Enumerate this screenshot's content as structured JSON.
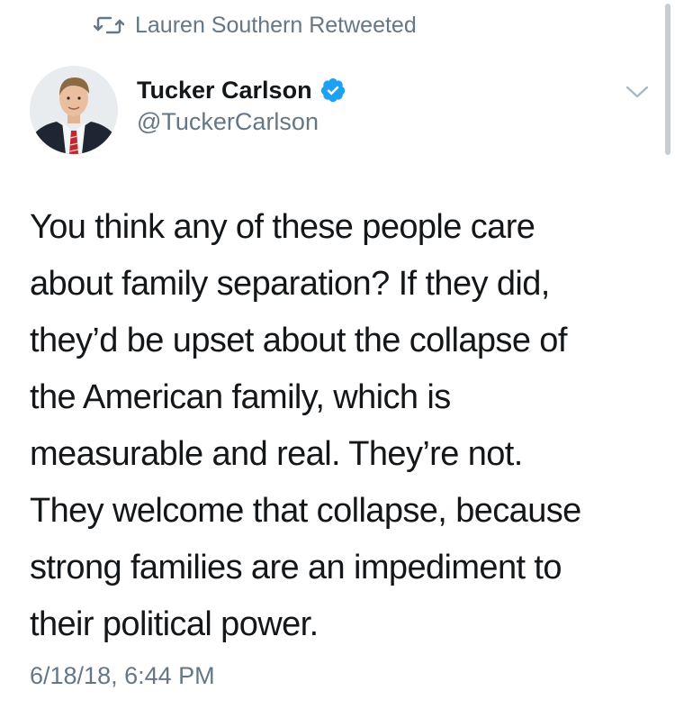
{
  "retweet_banner": {
    "icon": "retweet-icon",
    "text": "Lauren Southern Retweeted"
  },
  "author": {
    "display_name": "Tucker Carlson",
    "handle": "@TuckerCarlson",
    "verified_icon": "verified-badge-icon",
    "verified_color": "#1da1f2"
  },
  "menu": {
    "icon": "chevron-down-icon"
  },
  "tweet": {
    "lines": [
      "You think any of these people care",
      "about family separation? If they did,",
      "they’d be upset about the collapse of",
      "the American family, which is",
      "measurable and real. They’re not.",
      "They welcome that collapse, because",
      "strong families are an impediment to",
      "their political power."
    ],
    "timestamp": "6/18/18, 6:44 PM"
  },
  "colors": {
    "text_primary": "#14171a",
    "text_secondary": "#657786",
    "accent": "#1da1f2"
  }
}
